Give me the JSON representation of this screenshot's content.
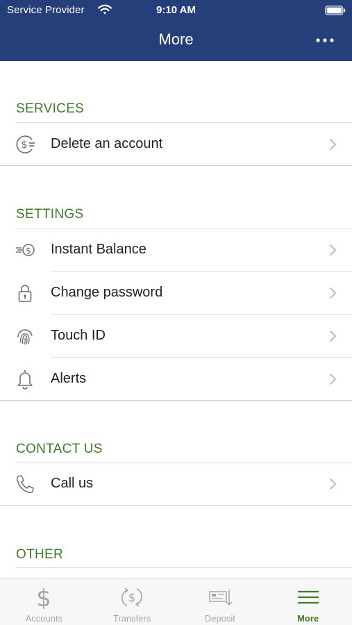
{
  "status_bar": {
    "carrier": "Service Provider",
    "time": "9:10 AM"
  },
  "nav": {
    "title": "More"
  },
  "sections": [
    {
      "title": "SERVICES",
      "items": [
        {
          "label": "Delete an account",
          "icon": "dollar-cycle-icon"
        }
      ]
    },
    {
      "title": "SETTINGS",
      "items": [
        {
          "label": "Instant Balance",
          "icon": "fast-dollar-icon"
        },
        {
          "label": "Change password",
          "icon": "lock-icon"
        },
        {
          "label": "Touch ID",
          "icon": "fingerprint-icon"
        },
        {
          "label": "Alerts",
          "icon": "bell-icon"
        }
      ]
    },
    {
      "title": "CONTACT US",
      "items": [
        {
          "label": "Call us",
          "icon": "phone-icon"
        }
      ]
    },
    {
      "title": "OTHER",
      "items": []
    }
  ],
  "tabs": [
    {
      "label": "Accounts",
      "icon": "dollar-icon",
      "active": false
    },
    {
      "label": "Transfers",
      "icon": "transfer-icon",
      "active": false
    },
    {
      "label": "Deposit",
      "icon": "check-deposit-icon",
      "active": false
    },
    {
      "label": "More",
      "icon": "menu-icon",
      "active": true
    }
  ],
  "colors": {
    "header": "#263f7a",
    "section_title": "#3d7a2a",
    "active_tab": "#3d7a2a",
    "inactive_tab": "#a5a5a5"
  }
}
